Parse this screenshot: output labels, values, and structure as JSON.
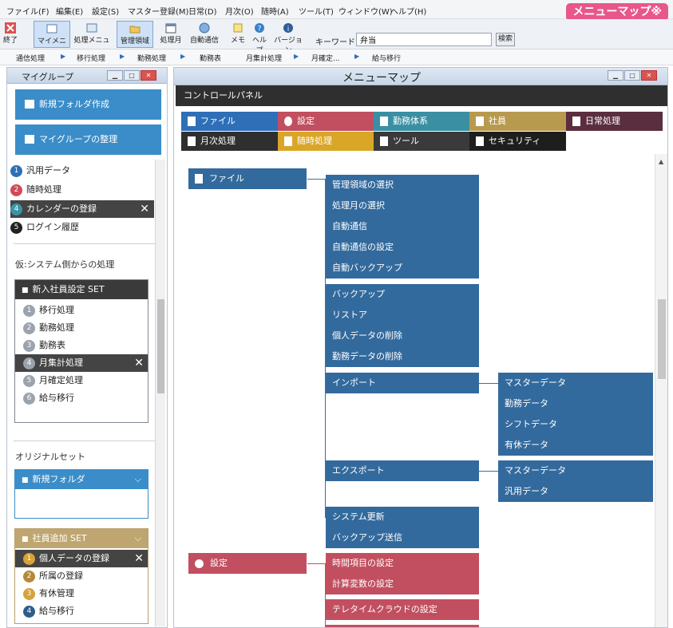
{
  "menubar": {
    "items": [
      "ファイル(F)",
      "編集(E)",
      "設定(S)",
      "マスター登録(M)",
      "日常(D)",
      "月次(O)",
      "随時(A)",
      "ツール(T)",
      "ウィンドウ(W)",
      "ヘルプ(H)"
    ],
    "badge": "メニューマップ※"
  },
  "toolbar": {
    "items": [
      "終了",
      "マイメニュー",
      "処理メニュー",
      "管理領域",
      "処理月",
      "自動通信",
      "メモ",
      "ヘルプ",
      "バージョン"
    ],
    "keyword_label": "キーワード",
    "keyword_value": "弁当",
    "search_label": "検索"
  },
  "breadcrumb": [
    "通信処理",
    "移行処理",
    "勤務処理",
    "勤務表",
    "月集計処理",
    "月確定...",
    "給与移行"
  ],
  "left": {
    "title": "マイグループ",
    "new_folder": "新規フォルダ作成",
    "organize": "マイグループの整理",
    "list": [
      {
        "n": "1",
        "label": "汎用データ",
        "color": "#2e6fb7"
      },
      {
        "n": "2",
        "label": "随時処理",
        "color": "#d04a5a"
      },
      {
        "n": "4",
        "label": "カレンダーの登録",
        "color": "#3a95a8"
      },
      {
        "n": "5",
        "label": "ログイン履歴",
        "color": "#222222"
      }
    ],
    "section_label": "仮:システム側からの処理",
    "set1": {
      "title": "新入社員設定 SET",
      "rows": [
        {
          "n": "1",
          "label": "移行処理"
        },
        {
          "n": "2",
          "label": "勤務処理"
        },
        {
          "n": "3",
          "label": "勤務表"
        },
        {
          "n": "4",
          "label": "月集計処理"
        },
        {
          "n": "5",
          "label": "月確定処理"
        },
        {
          "n": "6",
          "label": "給与移行"
        }
      ]
    },
    "original_label": "オリジナルセット",
    "folder": {
      "title": "新規フォルダ"
    },
    "set2": {
      "title": "社員追加 SET",
      "rows": [
        {
          "n": "1",
          "label": "個人データの登録",
          "color": "#d6a23a"
        },
        {
          "n": "2",
          "label": "所属の登録",
          "color": "#b48a3a"
        },
        {
          "n": "3",
          "label": "有休管理",
          "color": "#d6a23a"
        },
        {
          "n": "4",
          "label": "給与移行",
          "color": "#2e5d8a"
        }
      ]
    }
  },
  "right": {
    "title": "メニューマップ",
    "control_panel": "コントロールパネル",
    "categories": [
      {
        "label": "ファイル",
        "color": "#2e6fb7"
      },
      {
        "label": "設定",
        "color": "#c24f5f"
      },
      {
        "label": "勤務体系",
        "color": "#3a8fa3"
      },
      {
        "label": "社員",
        "color": "#b89a4f"
      },
      {
        "label": "日常処理",
        "color": "#5a2e3e"
      },
      {
        "label": "月次処理",
        "color": "#2f2f2f"
      },
      {
        "label": "随時処理",
        "color": "#d9a628"
      },
      {
        "label": "ツール",
        "color": "#3a3a3a"
      },
      {
        "label": "セキュリティ",
        "color": "#1e1e1e"
      }
    ],
    "map": {
      "file_root": "ファイル",
      "file_group1": [
        "管理領域の選択",
        "処理月の選択",
        "自動通信",
        "自動通信の設定",
        "自動バックアップ"
      ],
      "file_group2": [
        "バックアップ",
        "リストア",
        "個人データの削除",
        "勤務データの削除"
      ],
      "import": "インポート",
      "import_sub": [
        "マスターデータ",
        "勤務データ",
        "シフトデータ",
        "有休データ"
      ],
      "export": "エクスポート",
      "export_sub": [
        "マスターデータ",
        "汎用データ"
      ],
      "file_group3": [
        "システム更新",
        "バックアップ送信"
      ],
      "settings_root": "設定",
      "settings_group1": [
        "時間項目の設定",
        "計算変数の設定"
      ],
      "settings_group2": [
        "テレタイムクラウドの設定"
      ]
    }
  },
  "colors": {
    "blue": "#336a9d",
    "red": "#c24f5f"
  }
}
